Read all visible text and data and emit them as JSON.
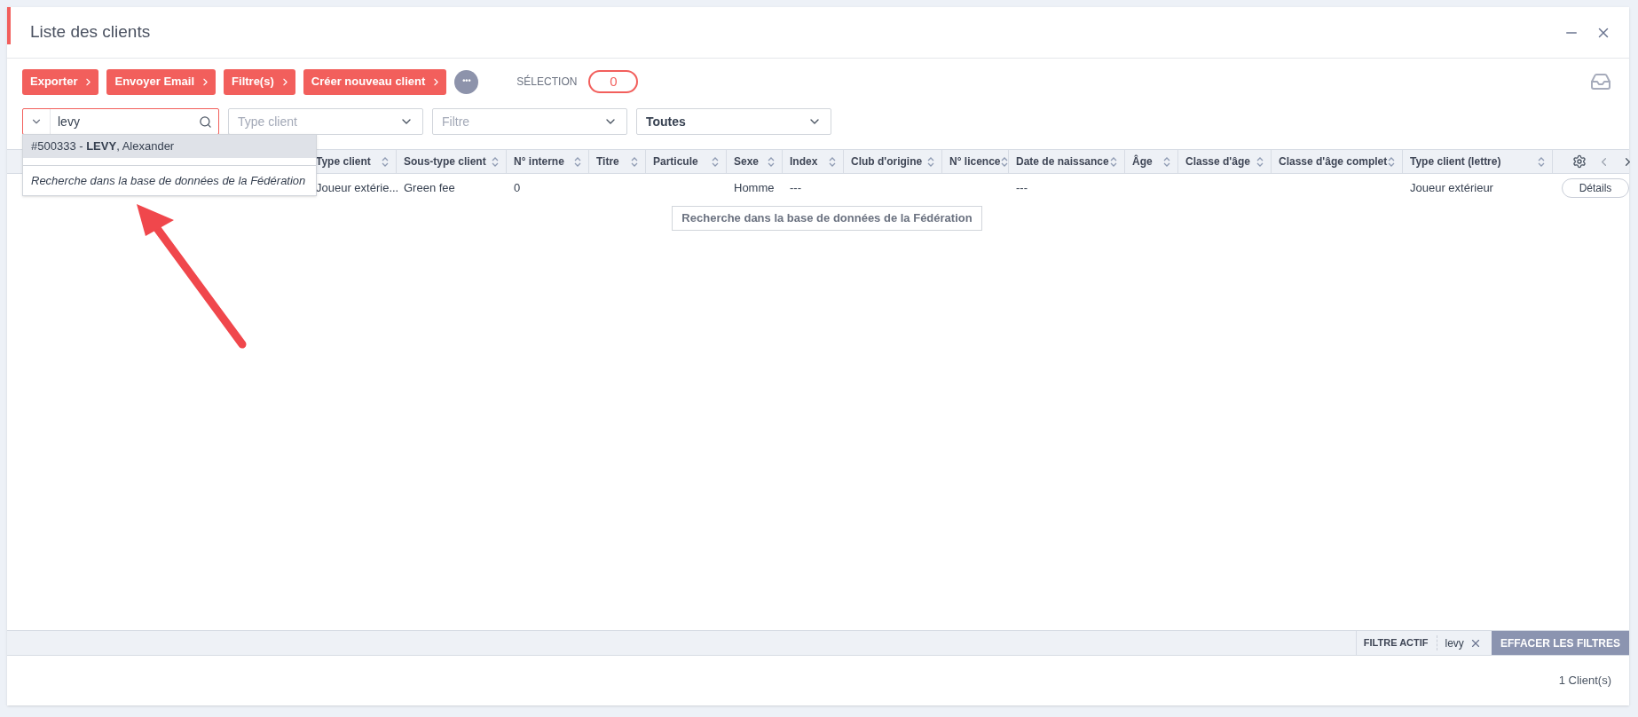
{
  "window": {
    "title": "Liste des clients"
  },
  "toolbar": {
    "buttons": [
      {
        "label": "Exporter"
      },
      {
        "label": "Envoyer Email"
      },
      {
        "label": "Filtre(s)"
      },
      {
        "label": "Créer nouveau client"
      }
    ],
    "more_button": "•••",
    "selection": {
      "label": "SÉLECTION",
      "count": "0"
    }
  },
  "filters": {
    "search": {
      "value": "levy"
    },
    "selects": [
      {
        "placeholder": "Type client"
      },
      {
        "placeholder": "Filtre"
      },
      {
        "value": "Toutes"
      }
    ]
  },
  "dropdown": {
    "items": [
      {
        "kind": "result",
        "text": "#500333 - **LEVY**, Alexander",
        "selected": true
      },
      {
        "kind": "action",
        "text": "Recherche dans la base de données de la Fédération",
        "selected": false
      }
    ]
  },
  "table": {
    "columns": [
      {
        "label": "Type client"
      },
      {
        "label": "Sous-type client"
      },
      {
        "label": "N° interne"
      },
      {
        "label": "Titre"
      },
      {
        "label": "Particule"
      },
      {
        "label": "Sexe"
      },
      {
        "label": "Index"
      },
      {
        "label": "Club d'origine"
      },
      {
        "label": "N° licence"
      },
      {
        "label": "Date de naissance"
      },
      {
        "label": "Âge"
      },
      {
        "label": "Classe d'âge"
      },
      {
        "label": "Classe d'âge complet"
      },
      {
        "label": "Type client (lettre)"
      }
    ],
    "rows": [
      {
        "cells": [
          "Joueur extérie...",
          "Green fee",
          "0",
          null,
          null,
          "Homme",
          "---",
          null,
          null,
          "---",
          null,
          null,
          null,
          "Joueur extérieur"
        ],
        "action": "Détails"
      }
    ],
    "federation_button": "Recherche dans la base de données de la Fédération"
  },
  "filter_bar": {
    "label": "FILTRE ACTIF",
    "chips": [
      {
        "text": "levy"
      }
    ],
    "clear_button": "EFFACER LES FILTRES"
  },
  "footer": {
    "count": "1 Client(s)"
  }
}
